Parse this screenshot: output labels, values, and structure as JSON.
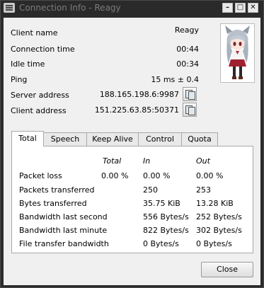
{
  "window": {
    "title": "Connection Info - Reagy",
    "buttons": {
      "minimize": "–",
      "maximize": "□",
      "close": "✕"
    }
  },
  "info": {
    "client_name_label": "Client name",
    "client_name": "Reagy",
    "connection_time_label": "Connection time",
    "connection_time": "00:44",
    "idle_time_label": "Idle time",
    "idle_time": "00:34",
    "ping_label": "Ping",
    "ping": "15 ms ± 0.4",
    "server_address_label": "Server address",
    "server_address": "188.165.198.6:9987",
    "client_address_label": "Client address",
    "client_address": "151.225.63.85:50371"
  },
  "icons": {
    "copy": "copy-icon",
    "avatar": "avatar-image"
  },
  "tabs": [
    {
      "label": "Total",
      "active": true
    },
    {
      "label": "Speech",
      "active": false
    },
    {
      "label": "Keep Alive",
      "active": false
    },
    {
      "label": "Control",
      "active": false
    },
    {
      "label": "Quota",
      "active": false
    }
  ],
  "stats": {
    "headers": {
      "total": "Total",
      "in": "In",
      "out": "Out"
    },
    "rows": [
      {
        "label": "Packet loss",
        "total": "0.00 %",
        "in": "0.00 %",
        "out": "0.00 %"
      },
      {
        "label": "Packets transferred",
        "total": "",
        "in": "250",
        "out": "253"
      },
      {
        "label": "Bytes transferred",
        "total": "",
        "in": "35.75 KiB",
        "out": "13.28 KiB"
      },
      {
        "label": "Bandwidth last second",
        "total": "",
        "in": "556 Bytes/s",
        "out": "252 Bytes/s"
      },
      {
        "label": "Bandwidth last minute",
        "total": "",
        "in": "822 Bytes/s",
        "out": "302 Bytes/s"
      },
      {
        "label": "File transfer bandwidth",
        "total": "",
        "in": "0 Bytes/s",
        "out": "0 Bytes/s"
      }
    ]
  },
  "close_label": "Close"
}
